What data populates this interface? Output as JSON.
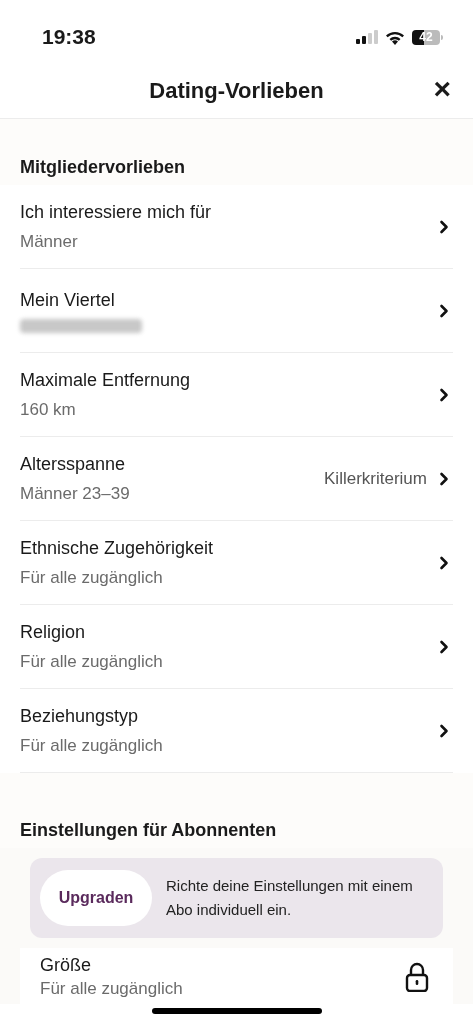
{
  "status_bar": {
    "time": "19:38",
    "battery": "42"
  },
  "header": {
    "title": "Dating-Vorlieben",
    "close": "×"
  },
  "sections": [
    {
      "title": "Mitgliedervorlieben",
      "rows": [
        {
          "label": "Ich interessiere mich für",
          "value": "Männer",
          "kind": "link"
        },
        {
          "label": "Mein Viertel",
          "kind": "redacted"
        },
        {
          "label": "Maximale Entfernung",
          "value": "160 km",
          "kind": "link"
        },
        {
          "label": "Altersspanne",
          "value": "Männer 23–39",
          "badge": "Killerkriterium",
          "kind": "link"
        },
        {
          "label": "Ethnische Zugehörigkeit",
          "value": "Für alle zugänglich",
          "kind": "link"
        },
        {
          "label": "Religion",
          "value": "Für alle zugänglich",
          "kind": "link"
        },
        {
          "label": "Beziehungstyp",
          "value": "Für alle zugänglich",
          "kind": "link"
        }
      ]
    },
    {
      "title": "Einstellungen für Abonnenten",
      "upgrade": {
        "button": "Upgraden",
        "text": "Richte deine Einstellungen mit einem Abo individuell ein."
      },
      "rows": [
        {
          "label": "Größe",
          "value": "Für alle zugänglich",
          "kind": "locked"
        }
      ]
    }
  ]
}
